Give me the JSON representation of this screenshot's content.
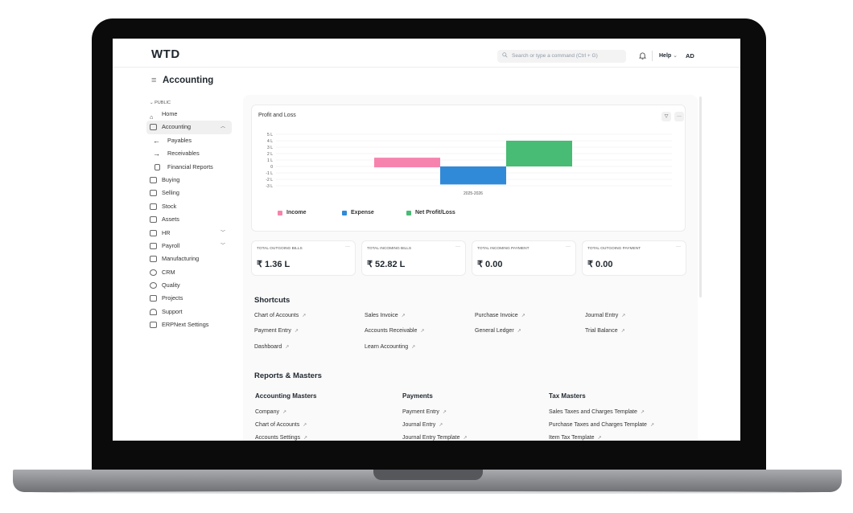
{
  "navbar": {
    "logo": "WTD",
    "search_placeholder": "Search or type a command (Ctrl + G)",
    "help_label": "Help",
    "avatar_initials": "AD"
  },
  "page": {
    "title": "Accounting"
  },
  "sidebar": {
    "section_label": "PUBLIC",
    "items": [
      {
        "label": "Home",
        "icon": "home-icon"
      },
      {
        "label": "Accounting",
        "icon": "accounting-icon",
        "active": true,
        "expanded": true
      },
      {
        "label": "Payables",
        "icon": "arrow-left-icon",
        "sub": true
      },
      {
        "label": "Receivables",
        "icon": "arrow-right-icon",
        "sub": true
      },
      {
        "label": "Financial Reports",
        "icon": "file-icon",
        "sub": true
      },
      {
        "label": "Buying",
        "icon": "shopping-bag-icon"
      },
      {
        "label": "Selling",
        "icon": "card-icon"
      },
      {
        "label": "Stock",
        "icon": "box-icon"
      },
      {
        "label": "Assets",
        "icon": "assets-icon"
      },
      {
        "label": "HR",
        "icon": "hr-icon",
        "collapsible": true
      },
      {
        "label": "Payroll",
        "icon": "payroll-icon",
        "collapsible": true
      },
      {
        "label": "Manufacturing",
        "icon": "factory-icon"
      },
      {
        "label": "CRM",
        "icon": "crm-icon"
      },
      {
        "label": "Quality",
        "icon": "quality-icon"
      },
      {
        "label": "Projects",
        "icon": "folder-icon"
      },
      {
        "label": "Support",
        "icon": "headset-icon"
      },
      {
        "label": "ERPNext Settings",
        "icon": "settings-icon"
      }
    ]
  },
  "chart_card": {
    "title": "Profit and Loss",
    "filter_icon": "filter-icon",
    "menu_icon": "more-icon"
  },
  "chart_data": {
    "type": "bar",
    "title": "Profit and Loss",
    "categories": [
      "2025-2026"
    ],
    "y_tick_labels": [
      "5 L",
      "4 L",
      "3 L",
      "2 L",
      "1 L",
      "0",
      "-1 L",
      "-2 L",
      "-3 L"
    ],
    "ylim": [
      -3,
      5
    ],
    "series": [
      {
        "name": "Income",
        "values": [
          1.36
        ],
        "color": "#f683ae"
      },
      {
        "name": "Expense",
        "values": [
          -2.8
        ],
        "color": "#318ad8"
      },
      {
        "name": "Net Profit/Loss",
        "values": [
          4.0
        ],
        "color": "#48bb74"
      }
    ],
    "grid": true,
    "legend_position": "bottom-left"
  },
  "number_cards": [
    {
      "label": "TOTAL OUTGOING BILLS",
      "value": "₹ 1.36 L"
    },
    {
      "label": "TOTAL INCOMING BILLS",
      "value": "₹ 52.82 L"
    },
    {
      "label": "TOTAL INCOMING PAYMENT",
      "value": "₹ 0.00"
    },
    {
      "label": "TOTAL OUTGOING PAYMENT",
      "value": "₹ 0.00"
    }
  ],
  "shortcuts": {
    "heading": "Shortcuts",
    "items": [
      "Chart of Accounts",
      "Sales Invoice",
      "Purchase Invoice",
      "Journal Entry",
      "Payment Entry",
      "Accounts Receivable",
      "General Ledger",
      "Trial Balance",
      "Dashboard",
      "Learn Accounting"
    ]
  },
  "reports": {
    "heading": "Reports & Masters",
    "columns": [
      {
        "title": "Accounting Masters",
        "links": [
          "Company",
          "Chart of Accounts",
          "Accounts Settings"
        ]
      },
      {
        "title": "Payments",
        "links": [
          "Payment Entry",
          "Journal Entry",
          "Journal Entry Template"
        ]
      },
      {
        "title": "Tax Masters",
        "links": [
          "Sales Taxes and Charges Template",
          "Purchase Taxes and Charges Template",
          "Item Tax Template"
        ]
      }
    ]
  }
}
